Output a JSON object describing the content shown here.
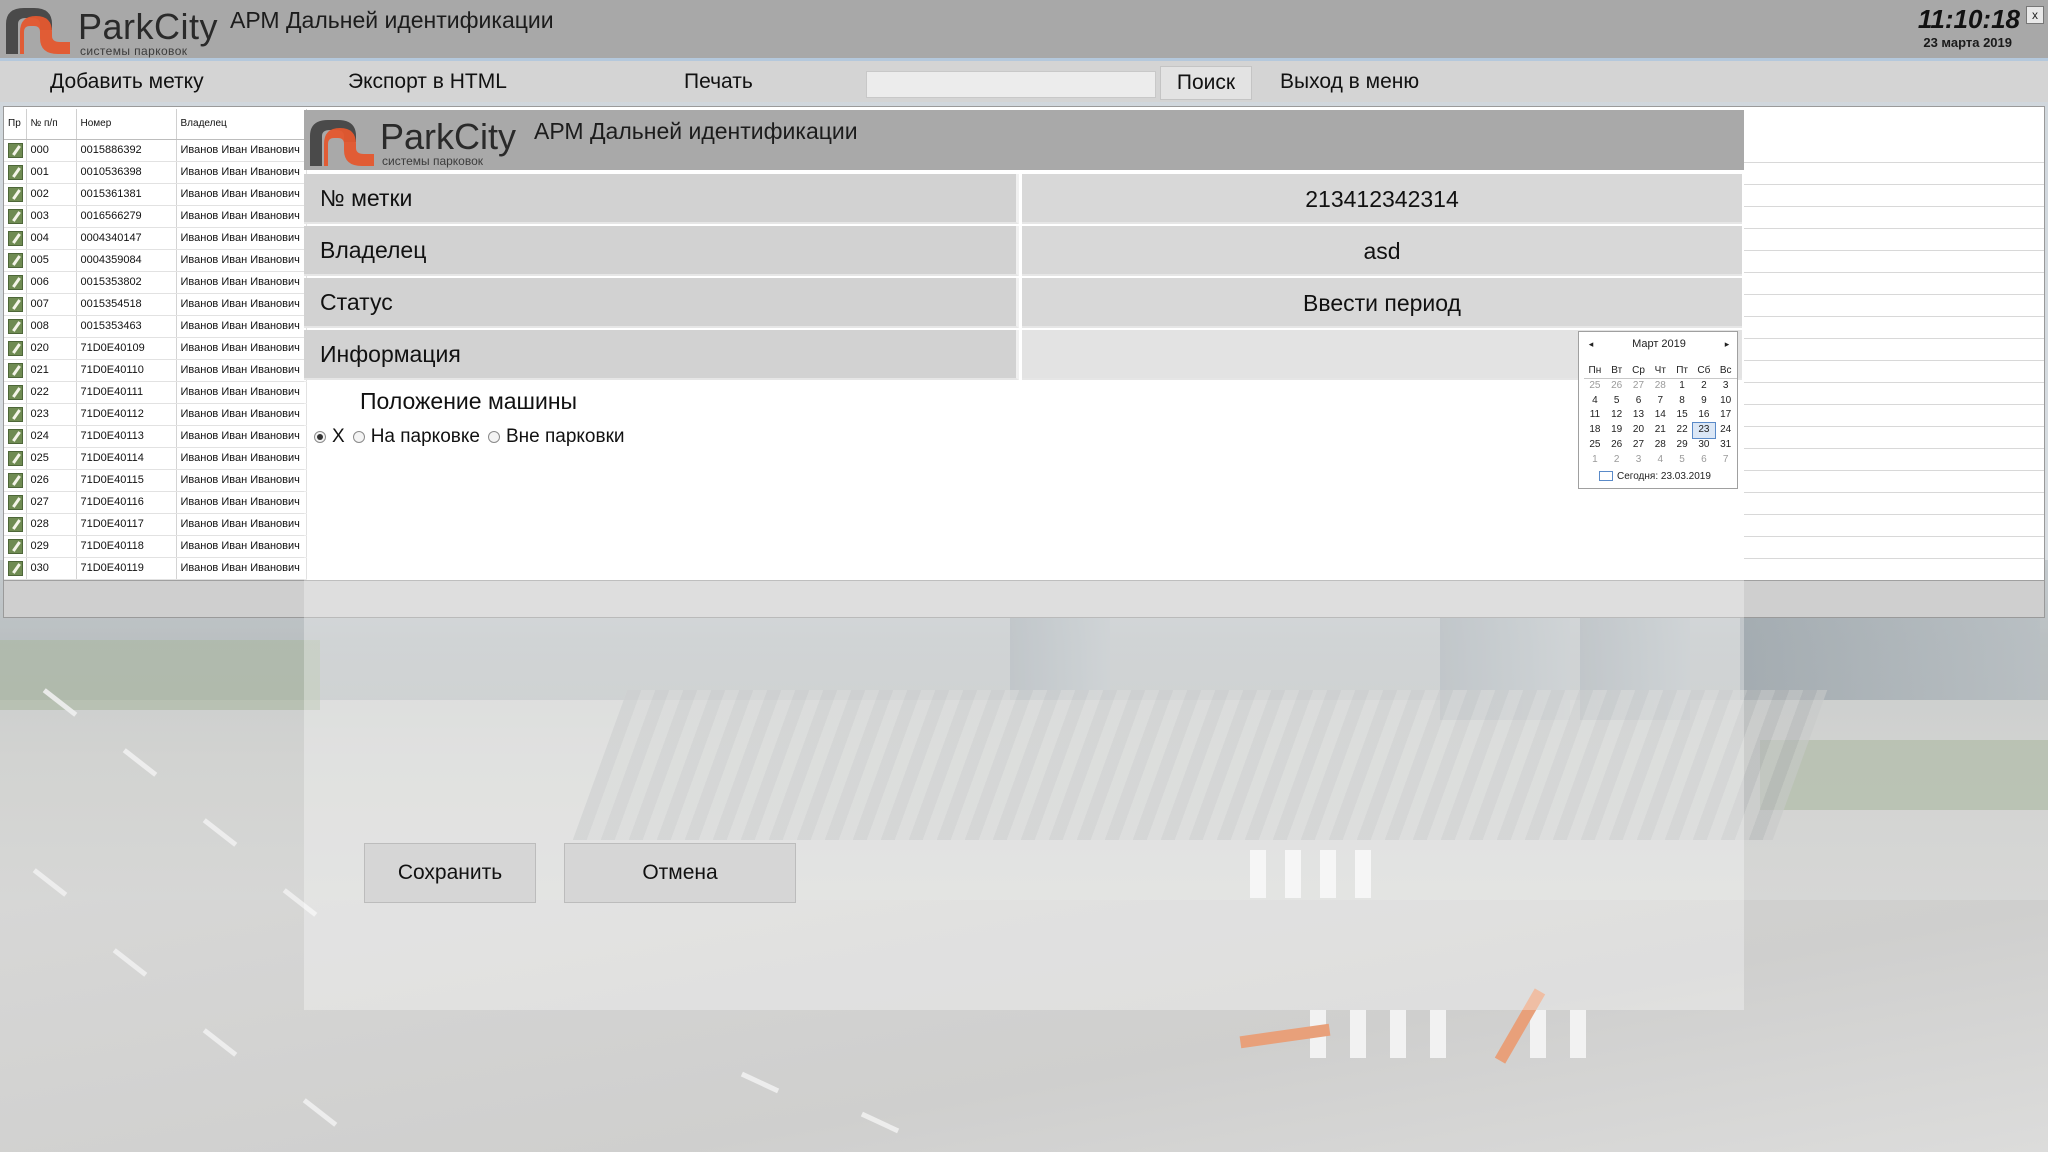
{
  "app": {
    "brand": "ParkCity",
    "brand_sub": "системы парковок",
    "title": "АРМ Дальней идентификации",
    "time": "11:10:18",
    "date": "23 марта 2019",
    "close": "x"
  },
  "toolbar": {
    "add_label": "Добавить метку",
    "export_label": "Экспорт в HTML",
    "print_label": "Печать",
    "search_value": "",
    "search_button": "Поиск",
    "exit_label": "Выход в меню"
  },
  "table": {
    "headers": [
      "Пр",
      "№ п/п",
      "Номер",
      "Владелец"
    ],
    "rows": [
      {
        "n": "000",
        "number": "0015886392",
        "owner": "Иванов Иван Иванович"
      },
      {
        "n": "001",
        "number": "0010536398",
        "owner": "Иванов Иван Иванович"
      },
      {
        "n": "002",
        "number": "0015361381",
        "owner": "Иванов Иван Иванович"
      },
      {
        "n": "003",
        "number": "0016566279",
        "owner": "Иванов Иван Иванович"
      },
      {
        "n": "004",
        "number": "0004340147",
        "owner": "Иванов Иван Иванович"
      },
      {
        "n": "005",
        "number": "0004359084",
        "owner": "Иванов Иван Иванович"
      },
      {
        "n": "006",
        "number": "0015353802",
        "owner": "Иванов Иван Иванович"
      },
      {
        "n": "007",
        "number": "0015354518",
        "owner": "Иванов Иван Иванович"
      },
      {
        "n": "008",
        "number": "0015353463",
        "owner": "Иванов Иван Иванович"
      },
      {
        "n": "020",
        "number": "71D0E40109",
        "owner": "Иванов Иван Иванович"
      },
      {
        "n": "021",
        "number": "71D0E40110",
        "owner": "Иванов Иван Иванович"
      },
      {
        "n": "022",
        "number": "71D0E40111",
        "owner": "Иванов Иван Иванович"
      },
      {
        "n": "023",
        "number": "71D0E40112",
        "owner": "Иванов Иван Иванович"
      },
      {
        "n": "024",
        "number": "71D0E40113",
        "owner": "Иванов Иван Иванович"
      },
      {
        "n": "025",
        "number": "71D0E40114",
        "owner": "Иванов Иван Иванович"
      },
      {
        "n": "026",
        "number": "71D0E40115",
        "owner": "Иванов Иван Иванович"
      },
      {
        "n": "027",
        "number": "71D0E40116",
        "owner": "Иванов Иван Иванович"
      },
      {
        "n": "028",
        "number": "71D0E40117",
        "owner": "Иванов Иван Иванович"
      },
      {
        "n": "029",
        "number": "71D0E40118",
        "owner": "Иванов Иван Иванович"
      },
      {
        "n": "030",
        "number": "71D0E40119",
        "owner": "Иванов Иван Иванович"
      }
    ]
  },
  "dialog": {
    "brand": "ParkCity",
    "brand_sub": "системы парковок",
    "title": "АРМ Дальней идентификации",
    "fields": [
      {
        "label": "№ метки",
        "value": "213412342314"
      },
      {
        "label": "Владелец",
        "value": "asd"
      },
      {
        "label": "Статус",
        "value": "Ввести период"
      },
      {
        "label": "Информация",
        "value": ""
      }
    ],
    "position_title": "Положение машины",
    "position_options": [
      {
        "label": "X",
        "selected": true
      },
      {
        "label": "На парковке",
        "selected": false
      },
      {
        "label": "Вне парковки",
        "selected": false
      }
    ],
    "save_label": "Сохранить",
    "cancel_label": "Отмена"
  },
  "calendar": {
    "month_label": "Март 2019",
    "prev": "◂",
    "next": "▸",
    "weekdays": [
      "Пн",
      "Вт",
      "Ср",
      "Чт",
      "Пт",
      "Сб",
      "Вс"
    ],
    "weeks": [
      [
        "25",
        "26",
        "27",
        "28",
        "1",
        "2",
        "3"
      ],
      [
        "4",
        "5",
        "6",
        "7",
        "8",
        "9",
        "10"
      ],
      [
        "11",
        "12",
        "13",
        "14",
        "15",
        "16",
        "17"
      ],
      [
        "18",
        "19",
        "20",
        "21",
        "22",
        "23",
        "24"
      ],
      [
        "25",
        "26",
        "27",
        "28",
        "29",
        "30",
        "31"
      ],
      [
        "1",
        "2",
        "3",
        "4",
        "5",
        "6",
        "7"
      ]
    ],
    "selected_day": "23",
    "today_label": "Сегодня: 23.03.2019"
  },
  "colors": {
    "logo_orange": "#e4572e",
    "logo_dark": "#4a4a4a",
    "accent_blue": "#5a8ac8"
  }
}
